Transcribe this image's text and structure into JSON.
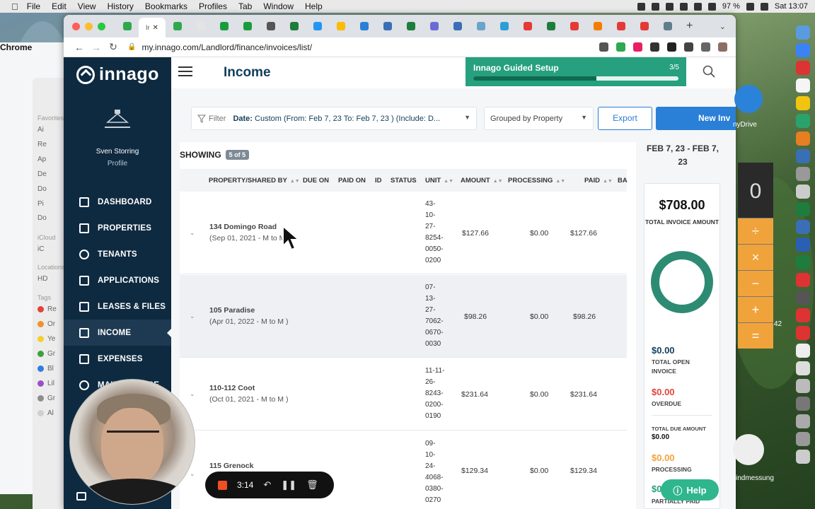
{
  "menubar": {
    "app": "Chrome",
    "items": [
      "File",
      "Edit",
      "View",
      "History",
      "Bookmarks",
      "Profiles",
      "Tab",
      "Window",
      "Help"
    ],
    "battery": "97 %",
    "clock": "Sat 13:07"
  },
  "finder": {
    "favorites_head": "Favorites",
    "favorites": [
      "Ai",
      "Re",
      "Ap",
      "De",
      "Do",
      "Pi",
      "Do"
    ],
    "icloud_head": "iCloud",
    "icloud": [
      "iC"
    ],
    "locations_head": "Locations",
    "locations": [
      "HD"
    ],
    "tags_head": "Tags",
    "tags": [
      {
        "label": "Re",
        "color": "#e0443a"
      },
      {
        "label": "Or",
        "color": "#f0922b"
      },
      {
        "label": "Ye",
        "color": "#f3cf2f"
      },
      {
        "label": "Gr",
        "color": "#3ba03e"
      },
      {
        "label": "Bl",
        "color": "#2f7de0"
      },
      {
        "label": "Lil",
        "color": "#9b4fc7"
      },
      {
        "label": "Gr",
        "color": "#8e8e8e"
      },
      {
        "label": "Al",
        "color": "#cfcfcf"
      }
    ]
  },
  "browser": {
    "active_tab_label": "Ir",
    "url": "my.innago.com/Landlord/finance/invoices/list/",
    "tab_favicon_colors": [
      "#2fa84f",
      "#e4e4e4",
      "#1a9c3e",
      "#1a9c3e",
      "#555555",
      "#1e7c3c",
      "#2196f3",
      "#fbbc04",
      "#2a7fd6",
      "#3a6fb5",
      "#1e7c3c",
      "#6b6bd6",
      "#3a6fb5",
      "#6aa4c9",
      "#2a9fd6",
      "#e53935",
      "#1e7c3c",
      "#e53935",
      "#f57c00",
      "#e53935",
      "#e53935",
      "#607d8b"
    ],
    "extension_colors": [
      "#555555",
      "#2fa84f",
      "#e91e63",
      "#333333",
      "#222222",
      "#444444",
      "#666666",
      "#8d6e63"
    ]
  },
  "app": {
    "brand": "innago",
    "user_name": "Sven Storring",
    "profile_label": "Profile",
    "nav": [
      {
        "label": "DASHBOARD",
        "icon": "dashboard-icon"
      },
      {
        "label": "PROPERTIES",
        "icon": "building-icon"
      },
      {
        "label": "TENANTS",
        "icon": "people-icon"
      },
      {
        "label": "APPLICATIONS",
        "icon": "clipboard-icon"
      },
      {
        "label": "LEASES & FILES",
        "icon": "document-icon"
      },
      {
        "label": "INCOME",
        "icon": "wallet-icon"
      },
      {
        "label": "EXPENSES",
        "icon": "card-icon"
      },
      {
        "label": "MAINTENANCE",
        "icon": "wrench-icon"
      }
    ],
    "active_nav": "INCOME",
    "page_title": "Income",
    "guided_setup": {
      "title": "Innago Guided Setup",
      "step": "3/5",
      "progress": 0.6
    },
    "filter": {
      "label": "Filter",
      "value_bold": "Date:",
      "value": "Custom (From: Feb 7, 23 To: Feb 7, 23 ) (Include: D..."
    },
    "group_by": "Grouped by Property",
    "export_label": "Export",
    "new_label": "New Inv",
    "showing_label": "SHOWING",
    "showing_badge": "5 of 5",
    "columns": [
      "PROPERTY/SHARED BY",
      "DUE ON",
      "PAID ON",
      "ID",
      "STATUS",
      "UNIT",
      "AMOUNT",
      "PROCESSING",
      "PAID",
      "BA"
    ],
    "rows": [
      {
        "property": "134 Domingo Road",
        "period": "(Sep 01, 2021 - M to M )",
        "unit": [
          "43-",
          "10-",
          "27-",
          "8254-",
          "0050-",
          "0200"
        ],
        "amount": "$127.66",
        "processing": "$0.00",
        "paid": "$127.66"
      },
      {
        "property": "105 Paradise",
        "period": "(Apr 01, 2022 - M to M )",
        "unit": [
          "07-",
          "13-",
          "27-",
          "7062-",
          "0670-",
          "0030"
        ],
        "amount": "$98.26",
        "processing": "$0.00",
        "paid": "$98.26"
      },
      {
        "property": "110-112 Coot",
        "period": "(Oct 01, 2021 - M to M )",
        "unit": [
          "11-11-",
          "26-",
          "8243-",
          "0200-",
          "0190"
        ],
        "amount": "$231.64",
        "processing": "$0.00",
        "paid": "$231.64"
      },
      {
        "property": "115 Grenock",
        "period": "",
        "unit": [
          "09-",
          "10-",
          "24-",
          "4068-",
          "0380-",
          "0270"
        ],
        "amount": "$129.34",
        "processing": "$0.00",
        "paid": "$129.34"
      }
    ],
    "summary": {
      "date_range": "FEB 7, 23 - FEB 7, 23",
      "total": "$708.00",
      "total_label": "TOTAL INVOICE AMOUNT",
      "open": "$0.00",
      "open_label": "TOTAL OPEN INVOICE",
      "overdue": "$0.00",
      "overdue_label": "OVERDUE",
      "due_label": "TOTAL DUE AMOUNT",
      "due": "$0.00",
      "processing": "$0.00",
      "processing_label": "PROCESSING",
      "partial": "$0",
      "partial_label": "PARTIALLY PAID",
      "colors": {
        "open": "#123e5c",
        "overdue": "#e0443a",
        "processing": "#f1a33b",
        "partial": "#26a07e",
        "donut": "#2e8b73"
      }
    }
  },
  "recorder": {
    "time": "3:14"
  },
  "help_label": "Help",
  "calculator": {
    "display": "0",
    "ops": [
      "÷",
      "×",
      "−",
      "+",
      "="
    ]
  },
  "desktop": {
    "onedrive_label": "nyDrive",
    "side_number": "42",
    "widget_label": "indmessung"
  }
}
